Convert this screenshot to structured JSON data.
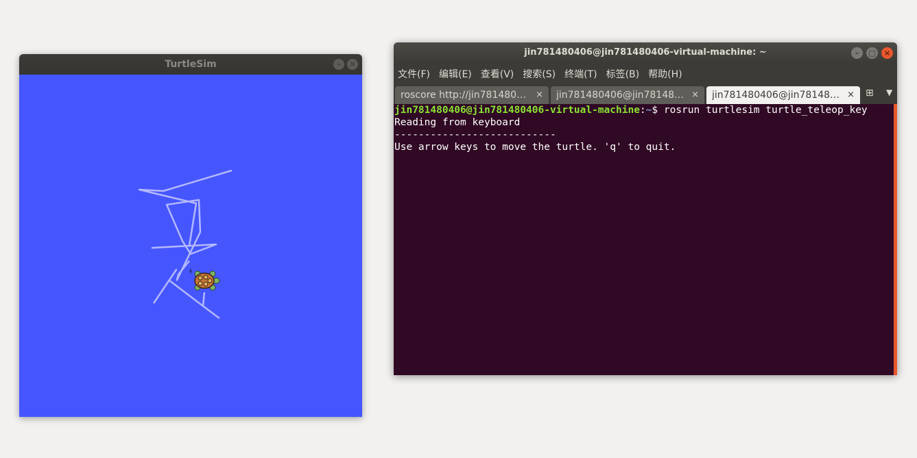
{
  "turtlesim": {
    "title": "TurtleSim",
    "background_color": "#4556ff",
    "pen_color": "#b3b8ff"
  },
  "terminal": {
    "title": "jin781480406@jin781480406-virtual-machine: ~",
    "menu": [
      "文件(F)",
      "编辑(E)",
      "查看(V)",
      "搜索(S)",
      "终端(T)",
      "标签(B)",
      "帮助(H)"
    ],
    "tabs": [
      {
        "label": "roscore http://jin7814804…",
        "active": false
      },
      {
        "label": "jin781480406@jin781480…",
        "active": false
      },
      {
        "label": "jin781480406@jin781480…",
        "active": true
      }
    ],
    "prompt_user": "jin781480406@jin781480406-virtual-machine",
    "prompt_path": "~",
    "prompt_symbol": "$",
    "command": " rosrun turtlesim turtle_teleop_key",
    "output": [
      "Reading from keyboard",
      "---------------------------",
      "Use arrow keys to move the turtle. 'q' to quit."
    ],
    "colors": {
      "background": "#300a24",
      "user": "#8ae234",
      "path": "#729fcf",
      "text": "#ffffff"
    }
  },
  "icons": {
    "minimize": "minimize-icon",
    "maximize": "maximize-icon",
    "close": "close-icon",
    "tab_close": "tab-close-icon",
    "new_tab": "new-tab-icon",
    "tab_menu": "chevron-down-icon",
    "turtle": "turtle-icon"
  }
}
